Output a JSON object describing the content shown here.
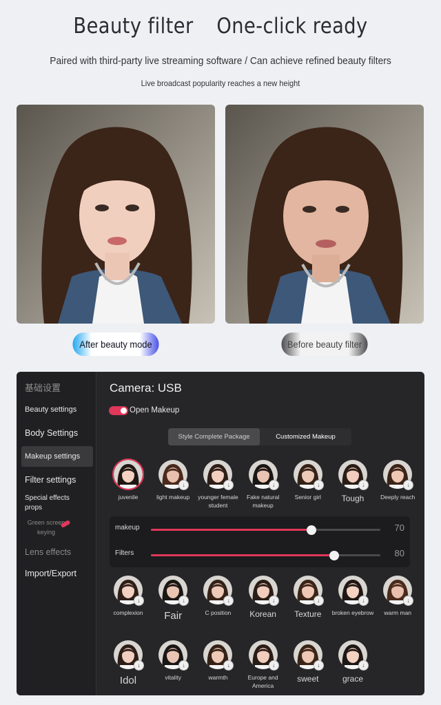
{
  "hero": {
    "title_left": "Beauty filter",
    "title_right": "One-click ready",
    "subtitle": "Paired with third-party live streaming software / Can achieve refined beauty filters",
    "tagline": "Live broadcast popularity reaches a new height"
  },
  "comparison": {
    "after_label": "After beauty mode",
    "before_label": "Before beauty filter"
  },
  "sidebar": {
    "header": "基础设置",
    "items": [
      {
        "label": "Beauty settings"
      },
      {
        "label": "Body Settings"
      },
      {
        "label": "Makeup settings"
      },
      {
        "label": "Filter settings"
      },
      {
        "label": "Special effects props"
      },
      {
        "label": "Green screen keying"
      },
      {
        "label": "Lens effects"
      },
      {
        "label": "Import/Export"
      }
    ]
  },
  "main": {
    "camera_title": "Camera: USB",
    "open_makeup_label": "Open Makeup",
    "open_makeup_on": true,
    "tabs": [
      {
        "label": "Style Complete Package"
      },
      {
        "label": "Customized Makeup"
      }
    ],
    "style_presets": [
      {
        "label": "juvenile",
        "selected": true
      },
      {
        "label": "light makeup"
      },
      {
        "label": "younger female student"
      },
      {
        "label": "Fake natural makeup"
      },
      {
        "label": "Senior girl"
      },
      {
        "label": "Tough"
      },
      {
        "label": "Deeply reach"
      }
    ],
    "sliders": [
      {
        "label": "makeup",
        "value": 70
      },
      {
        "label": "Filters",
        "value": 80
      }
    ],
    "filter_presets_row1": [
      {
        "label": "complexion"
      },
      {
        "label": "Fair"
      },
      {
        "label": "C position"
      },
      {
        "label": "Korean"
      },
      {
        "label": "Texture"
      },
      {
        "label": "broken eyebrow"
      },
      {
        "label": "warm man"
      }
    ],
    "filter_presets_row2": [
      {
        "label": "Idol"
      },
      {
        "label": "vitality"
      },
      {
        "label": "warmth"
      },
      {
        "label": "Europe and America"
      },
      {
        "label": "sweet"
      },
      {
        "label": "grace"
      }
    ]
  },
  "colors": {
    "accent": "#e0375a",
    "panel_bg": "#262628",
    "page_bg": "#eef0f4"
  }
}
